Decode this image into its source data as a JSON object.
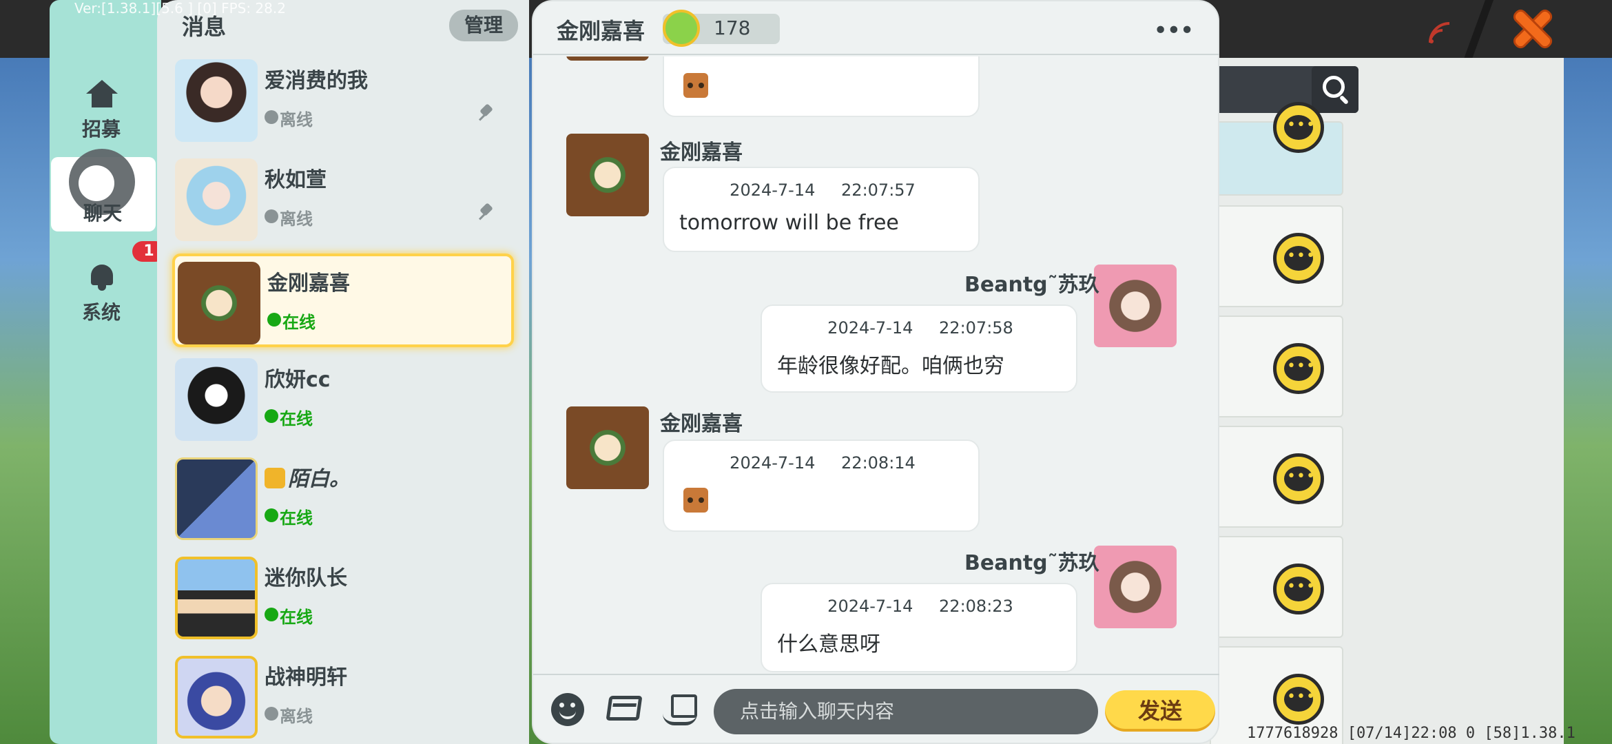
{
  "debug": {
    "fps_text": "Ver:[1.38.1][5.6    ]   [0] FPS: 28.2",
    "bottom_status": "1777618928    [07/14]22:08 0    [58]1.38.1"
  },
  "nav": {
    "items": [
      {
        "label": "招募",
        "icon": "house-icon"
      },
      {
        "label": "聊天",
        "icon": "chat-toggle-icon"
      },
      {
        "label": "系统",
        "icon": "bell-icon"
      }
    ],
    "system_badge": "1"
  },
  "contacts_panel": {
    "title": "消息",
    "manage_label": "管理",
    "contacts": [
      {
        "name": "爱消费的我",
        "status": "离线",
        "pinned": true
      },
      {
        "name": "秋如萱",
        "status": "离线",
        "pinned": true
      },
      {
        "name": "金刚嘉喜",
        "status": "在线",
        "selected": true
      },
      {
        "name": "欣妍cc",
        "status": "在线"
      },
      {
        "name": "陌白。",
        "status": "在线"
      },
      {
        "name": "迷你队长",
        "status": "在线"
      },
      {
        "name": "战神明轩",
        "status": "离线"
      }
    ]
  },
  "chat": {
    "title": "金刚嘉喜",
    "clover_count": "178",
    "messages": [
      {
        "sender": "金刚嘉喜",
        "side": "left",
        "date": "2024-7-14",
        "time": "22:07:57",
        "text": "tomorrow  will  be  free"
      },
      {
        "sender": "Beantg˜苏玖",
        "side": "right",
        "date": "2024-7-14",
        "time": "22:07:58",
        "text": "年龄很像好配。咱俩也穷"
      },
      {
        "sender": "金刚嘉喜",
        "side": "left",
        "date": "2024-7-14",
        "time": "22:08:14",
        "text": ""
      },
      {
        "sender": "Beantg˜苏玖",
        "side": "right",
        "date": "2024-7-14",
        "time": "22:08:23",
        "text": "什么意思呀"
      }
    ],
    "input_placeholder": "点击输入聊天内容",
    "send_label": "发送"
  },
  "colors": {
    "nav_bg": "#a6e2d6",
    "online": "#17a814",
    "offline": "#8a9395",
    "send_button": "#ffd94a",
    "selected_border": "#ffd24a"
  }
}
